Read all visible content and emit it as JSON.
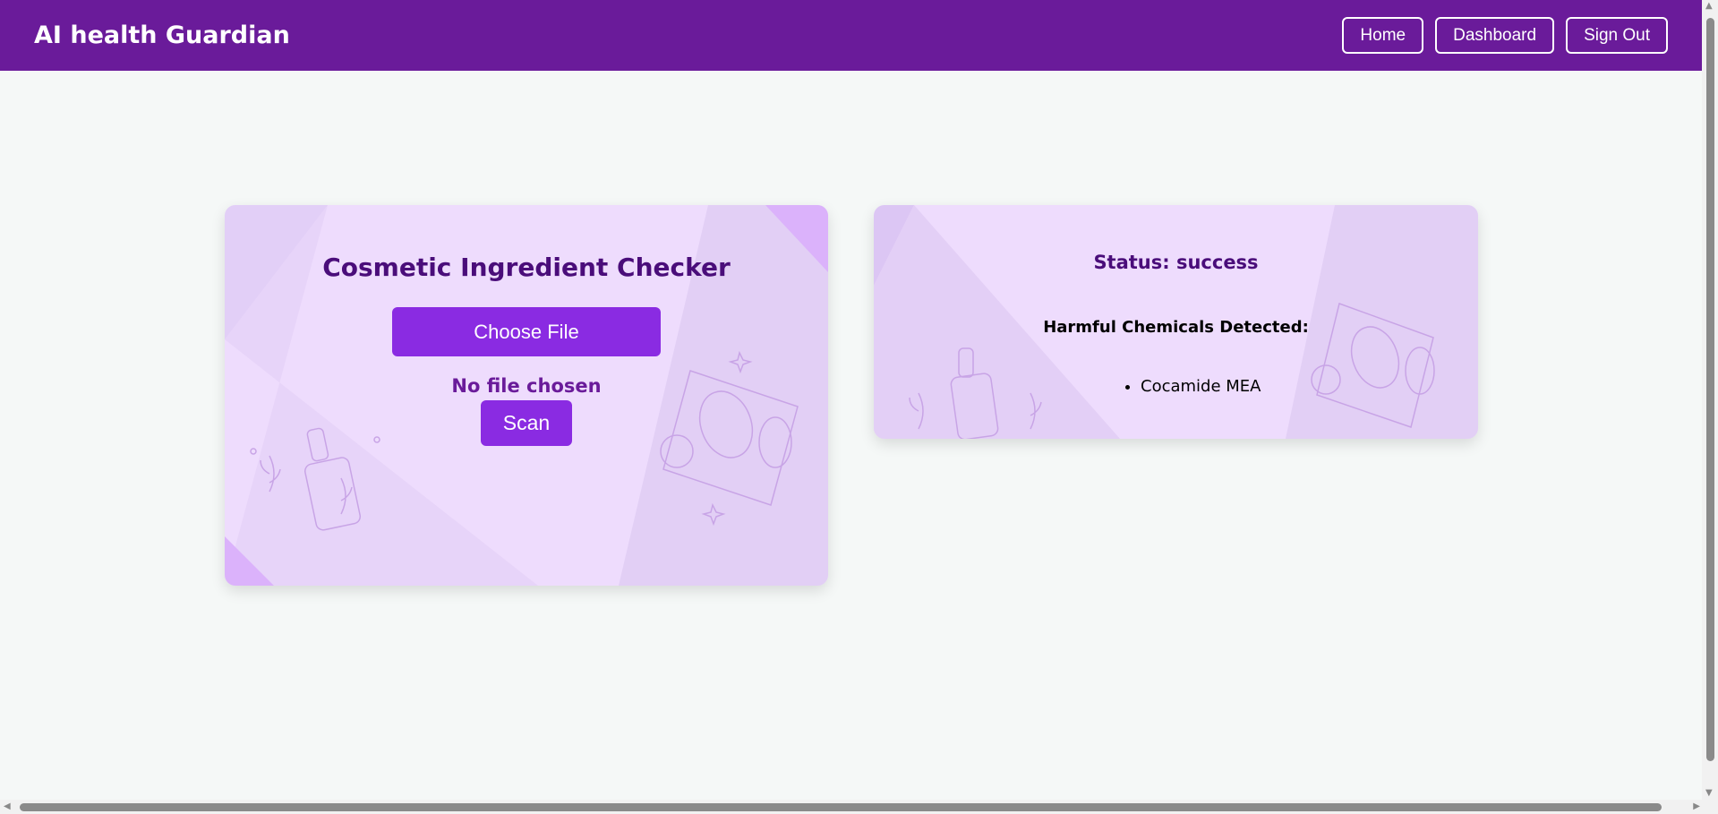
{
  "header": {
    "title": "AI health Guardian",
    "nav": [
      {
        "label": "Home"
      },
      {
        "label": "Dashboard"
      },
      {
        "label": "Sign Out"
      }
    ]
  },
  "checker": {
    "title": "Cosmetic Ingredient Checker",
    "choose_label": "Choose File",
    "file_status": "No file chosen",
    "scan_label": "Scan"
  },
  "result": {
    "status": "Status: success",
    "heading": "Harmful Chemicals Detected:",
    "chemicals": [
      "Cocamide MEA"
    ]
  },
  "colors": {
    "header": "#6a1b9a",
    "button": "#8a2be2",
    "card": "#eedcfd"
  }
}
